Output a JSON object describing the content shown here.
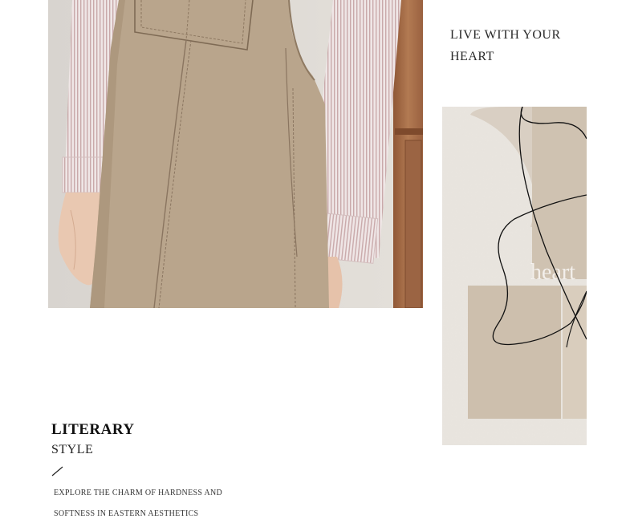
{
  "tagline": [
    "LIVE WITH YOUR",
    "HEART"
  ],
  "headline": {
    "line1": "LITERARY",
    "line2": "STYLE"
  },
  "description": [
    "EXPLORE THE CHARM OF HARDNESS AND",
    "SOFTNESS IN EASTERN AESTHETICS"
  ],
  "art": {
    "watermark_text": "heart"
  },
  "colors": {
    "background": "#ffffff",
    "dress": "#b9a58c",
    "shirt": "#e8dcdc",
    "wood": "#a9704a",
    "art_bg": "#e9e5df"
  }
}
